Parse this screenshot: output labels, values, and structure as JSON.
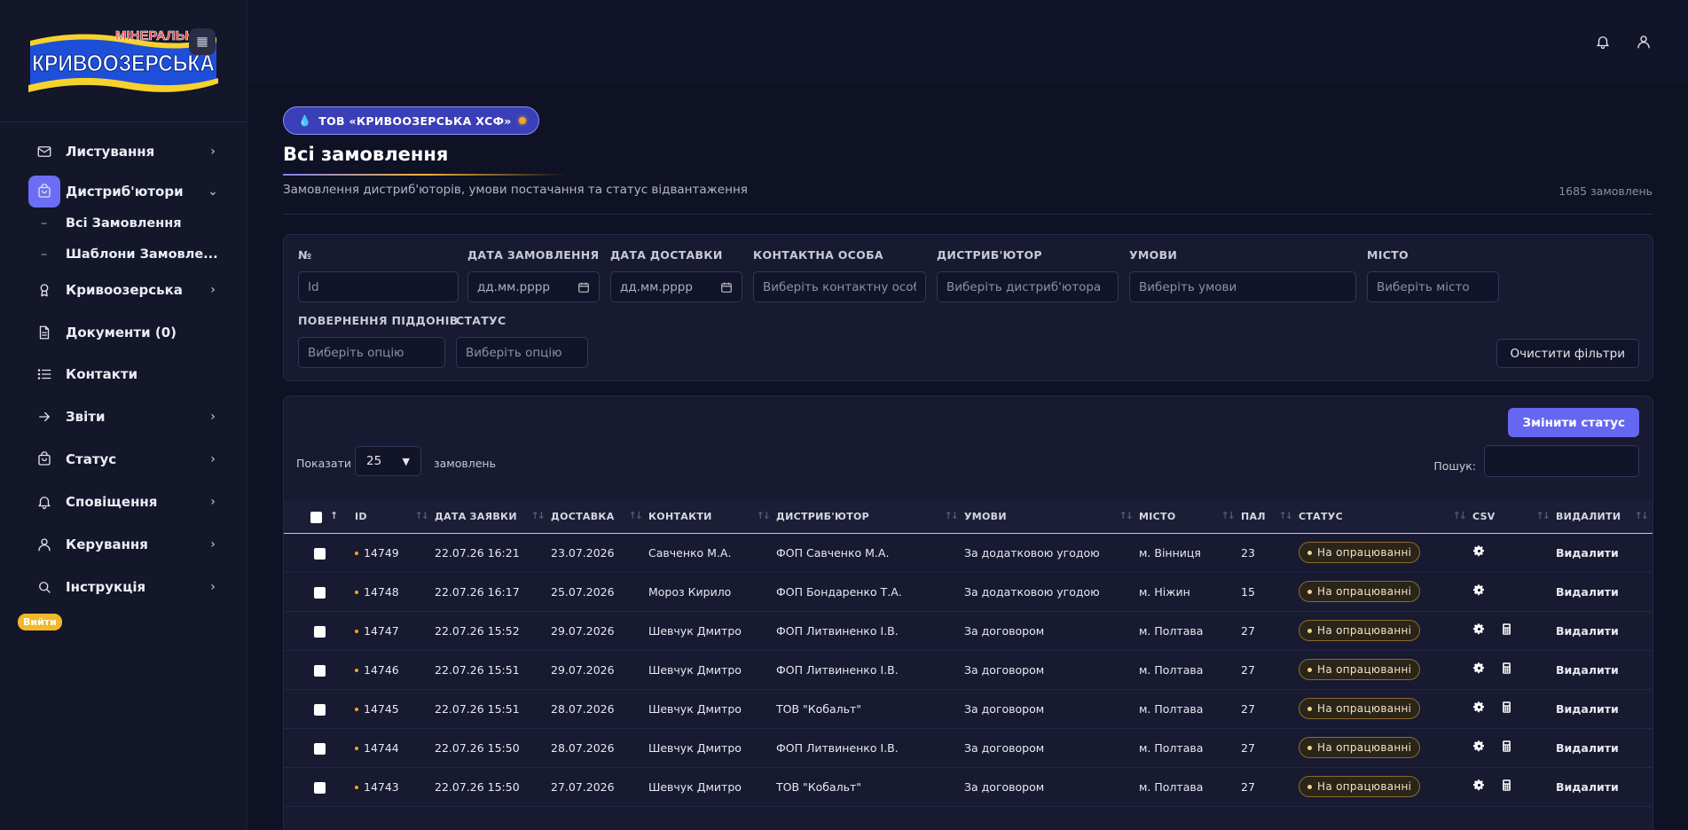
{
  "brand": {
    "logo_top": "МІНЕРАЛЬНА",
    "logo_main": "КРИВООЗЕРСЬКА",
    "colors": {
      "accent": "#6567f0",
      "gold": "#f5a623",
      "logo_blue": "#1e4fd8",
      "logo_yellow": "#f7d22b",
      "logo_red": "#e53935"
    }
  },
  "sidebar": {
    "items": [
      {
        "label": "Листування",
        "icon": "mail-icon",
        "chevron": "›"
      },
      {
        "label": "Дистриб'ютори",
        "icon": "shopping-bag-icon",
        "chevron": "⌄",
        "active": true
      },
      {
        "label": "Кривоозерська",
        "icon": "award-icon",
        "chevron": "›"
      },
      {
        "label": "Документи (0)",
        "icon": "document-icon",
        "chevron": ""
      },
      {
        "label": "Контакти",
        "icon": "list-icon",
        "chevron": ""
      },
      {
        "label": "Звіти",
        "icon": "arrow-right-icon",
        "chevron": "›"
      },
      {
        "label": "Статус",
        "icon": "bag-icon",
        "chevron": "›"
      },
      {
        "label": "Сповіщення",
        "icon": "bell-icon",
        "chevron": "›"
      },
      {
        "label": "Керування",
        "icon": "user-icon",
        "chevron": "›"
      },
      {
        "label": "Інструкція",
        "icon": "search-icon",
        "chevron": "›"
      }
    ],
    "subitems": [
      {
        "label": "Всі Замовлення"
      },
      {
        "label": "Шаблони Замовле..."
      }
    ],
    "logout": "Вийти"
  },
  "header": {
    "company": "ТОВ «КРИВООЗЕРСЬКА ХСФ»",
    "title": "Всі замовлення",
    "subtitle": "Замовлення дистриб'юторів, умови постачання та статус відвантаження",
    "count": "1685 замовлень"
  },
  "filters": {
    "num_label": "№",
    "num_placeholder": "Id",
    "order_date_label": "ДАТА ЗАМОВЛЕННЯ",
    "order_date_placeholder": "дд.мм.рррр",
    "delivery_date_label": "ДАТА ДОСТАВКИ",
    "delivery_date_placeholder": "дд.мм.рррр",
    "contact_label": "КОНТАКТНА ОСОБА",
    "contact_placeholder": "Виберіть контактну особу",
    "distributor_label": "ДИСТРИБ'ЮТОР",
    "distributor_placeholder": "Виберіть дистриб'ютора",
    "terms_label": "УМОВИ",
    "terms_placeholder": "Виберіть умови",
    "city_label": "МІСТО",
    "city_placeholder": "Виберіть місто",
    "pallet_label": "ПОВЕРНЕННЯ ПІДДОНІВ",
    "pallet_placeholder": "Виберіть опцію",
    "status_label": "СТАТУС",
    "status_placeholder": "Виберіть опцію",
    "clear": "Очистити фільтри"
  },
  "table_controls": {
    "change_status": "Змінити статус",
    "show": "Показати",
    "page_size": "25",
    "suffix": "замовлень",
    "search": "Пошук:"
  },
  "table": {
    "columns": [
      "ID",
      "ДАТА ЗАЯВКИ",
      "ДОСТАВКА",
      "КОНТАКТИ",
      "ДИСТРИБ'ЮТОР",
      "УМОВИ",
      "МІСТО",
      "ПАЛ",
      "СТАТУС",
      "CSV",
      "ВИДАЛИТИ"
    ],
    "delete_label": "Видалити",
    "rows": [
      {
        "id": "14749",
        "date": "22.07.26 16:21",
        "delivery": "23.07.2026",
        "contact": "Савченко М.А.",
        "distributor": "ФОП Савченко М.А.",
        "terms": "За додатковою угодою",
        "city": "м. Вінниця",
        "pal": "23",
        "status": "На опрацюванні",
        "calc": false
      },
      {
        "id": "14748",
        "date": "22.07.26 16:17",
        "delivery": "25.07.2026",
        "contact": "Мороз Кирило",
        "distributor": "ФОП Бондаренко Т.А.",
        "terms": "За додатковою угодою",
        "city": "м. Ніжин",
        "pal": "15",
        "status": "На опрацюванні",
        "calc": false
      },
      {
        "id": "14747",
        "date": "22.07.26 15:52",
        "delivery": "29.07.2026",
        "contact": "Шевчук Дмитро",
        "distributor": "ФОП Литвиненко І.В.",
        "terms": "За договором",
        "city": "м. Полтава",
        "pal": "27",
        "status": "На опрацюванні",
        "calc": true
      },
      {
        "id": "14746",
        "date": "22.07.26 15:51",
        "delivery": "29.07.2026",
        "contact": "Шевчук Дмитро",
        "distributor": "ФОП Литвиненко І.В.",
        "terms": "За договором",
        "city": "м. Полтава",
        "pal": "27",
        "status": "На опрацюванні",
        "calc": true
      },
      {
        "id": "14745",
        "date": "22.07.26 15:51",
        "delivery": "28.07.2026",
        "contact": "Шевчук Дмитро",
        "distributor": "ТОВ \"Кобальт\"",
        "terms": "За договором",
        "city": "м. Полтава",
        "pal": "27",
        "status": "На опрацюванні",
        "calc": true
      },
      {
        "id": "14744",
        "date": "22.07.26 15:50",
        "delivery": "28.07.2026",
        "contact": "Шевчук Дмитро",
        "distributor": "ФОП Литвиненко І.В.",
        "terms": "За договором",
        "city": "м. Полтава",
        "pal": "27",
        "status": "На опрацюванні",
        "calc": true
      },
      {
        "id": "14743",
        "date": "22.07.26 15:50",
        "delivery": "27.07.2026",
        "contact": "Шевчук Дмитро",
        "distributor": "ТОВ \"Кобальт\"",
        "terms": "За договором",
        "city": "м. Полтава",
        "pal": "27",
        "status": "На опрацюванні",
        "calc": true
      }
    ]
  }
}
